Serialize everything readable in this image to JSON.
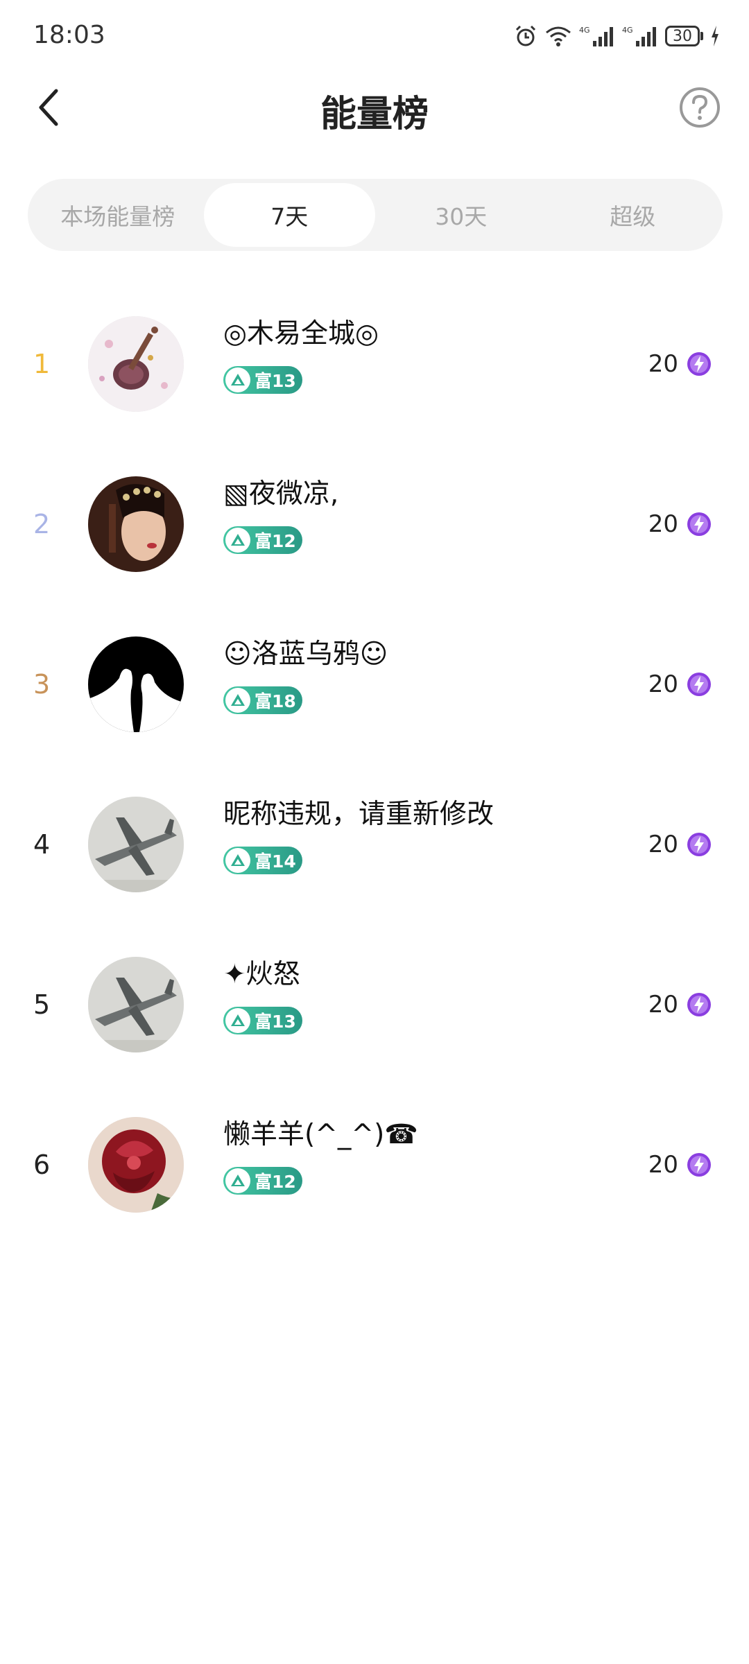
{
  "status": {
    "time": "18:03",
    "battery": "30",
    "network_1": "4G",
    "network_2": "4G"
  },
  "header": {
    "title": "能量榜"
  },
  "tabs": [
    {
      "label": "本场能量榜",
      "active": false
    },
    {
      "label": "7天",
      "active": true
    },
    {
      "label": "30天",
      "active": false
    },
    {
      "label": "超级",
      "active": false
    }
  ],
  "ranking": [
    {
      "rank": "1",
      "name": "◎木易全城◎",
      "badge": "富13",
      "score": "20"
    },
    {
      "rank": "2",
      "name": "▧夜微凉,",
      "badge": "富12",
      "score": "20"
    },
    {
      "rank": "3",
      "name": "☺洛蓝乌鸦☺",
      "badge": "富18",
      "score": "20"
    },
    {
      "rank": "4",
      "name": "昵称违规，请重新修改",
      "badge": "富14",
      "score": "20"
    },
    {
      "rank": "5",
      "name": "✦炏怒",
      "badge": "富13",
      "score": "20"
    },
    {
      "rank": "6",
      "name": "懒羊羊(^_^)☎",
      "badge": "富12",
      "score": "20"
    }
  ],
  "colors": {
    "rank_1": "#f0b93a",
    "rank_2": "#a9b4e6",
    "rank_3": "#c8935a",
    "badge": "#2fae90",
    "energy_icon": "#8a3ee0"
  },
  "icons": {
    "back": "chevron-left-icon",
    "help": "question-circle-icon",
    "energy": "lightning-icon",
    "badge": "wealth-level-icon"
  }
}
